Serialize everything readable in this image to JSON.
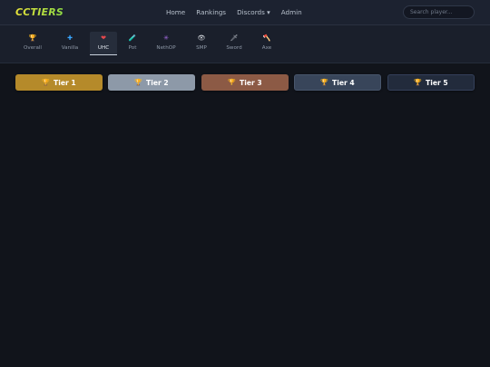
{
  "header": {
    "logo": "CCTIERS",
    "nav": [
      "Home",
      "Rankings",
      "Discords ▾",
      "Admin"
    ],
    "search_placeholder": "Search player..."
  },
  "modes": [
    {
      "label": "Overall",
      "icon": "🏆",
      "icon_name": "trophy-icon"
    },
    {
      "label": "Vanilla",
      "icon": "✚",
      "icon_name": "cross-icon"
    },
    {
      "label": "UHC",
      "icon": "❤",
      "icon_name": "heart-icon",
      "active": true
    },
    {
      "label": "Pot",
      "icon": "🧪",
      "icon_name": "potion-icon"
    },
    {
      "label": "NethOP",
      "icon": "✳",
      "icon_name": "nether-icon"
    },
    {
      "label": "SMP",
      "icon": "👁",
      "icon_name": "eye-icon"
    },
    {
      "label": "Sword",
      "icon": "🗡",
      "icon_name": "sword-icon"
    },
    {
      "label": "Axe",
      "icon": "🪓",
      "icon_name": "axe-icon"
    }
  ],
  "tiers": [
    {
      "label": "Tier 1",
      "color": "#b58a2a"
    },
    {
      "label": "Tier 2",
      "color": "#8d99a8"
    },
    {
      "label": "Tier 3",
      "color": "#8c5a45"
    },
    {
      "label": "Tier 4",
      "color": "#38455a"
    },
    {
      "label": "Tier 5",
      "color": "#222b3c"
    }
  ],
  "tier_icon": "🏆"
}
